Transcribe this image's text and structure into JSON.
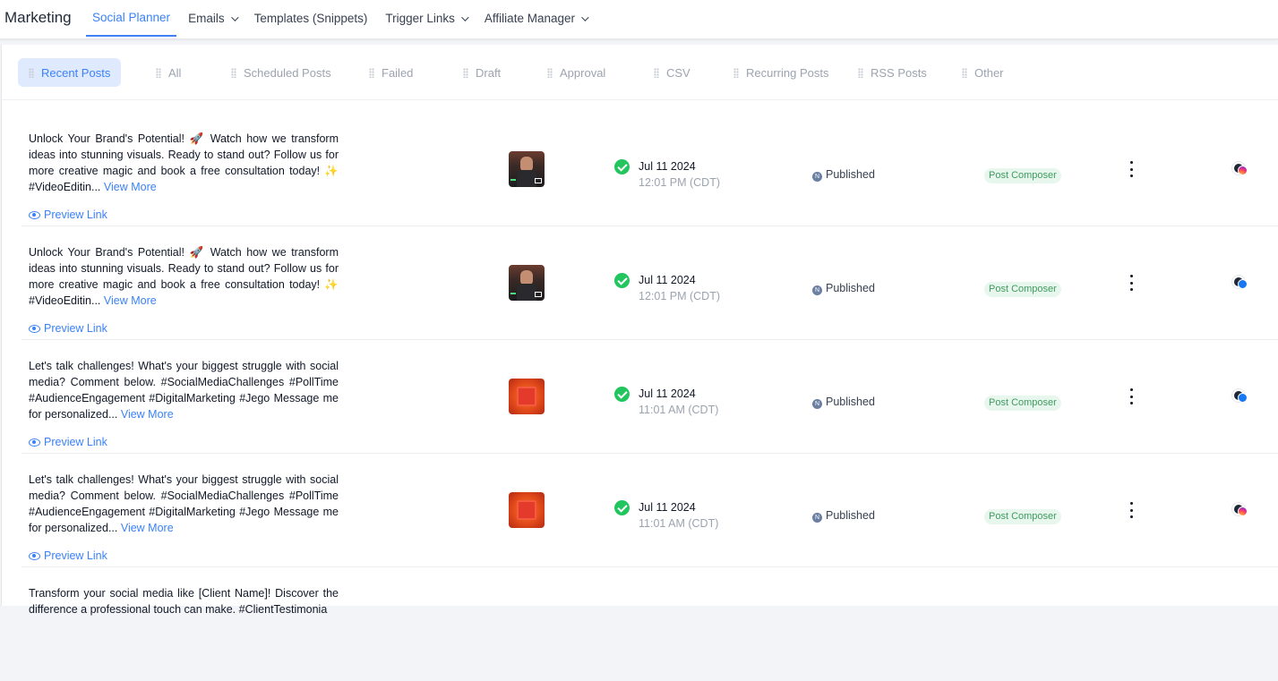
{
  "header": {
    "brand": "Marketing",
    "nav": [
      {
        "label": "Social Planner",
        "active": true,
        "dropdown": false
      },
      {
        "label": "Emails",
        "active": false,
        "dropdown": true
      },
      {
        "label": "Templates (Snippets)",
        "active": false,
        "dropdown": false
      },
      {
        "label": "Trigger Links",
        "active": false,
        "dropdown": true
      },
      {
        "label": "Affiliate Manager",
        "active": false,
        "dropdown": true
      }
    ]
  },
  "tabs": [
    {
      "label": "Recent Posts",
      "active": true
    },
    {
      "label": "All"
    },
    {
      "label": "Scheduled Posts"
    },
    {
      "label": "Failed"
    },
    {
      "label": "Draft"
    },
    {
      "label": "Approval"
    },
    {
      "label": "CSV"
    },
    {
      "label": "Recurring Posts"
    },
    {
      "label": "RSS Posts"
    },
    {
      "label": "Other"
    }
  ],
  "posts": [
    {
      "caption": "Unlock Your Brand's Potential! 🚀 Watch how we transform ideas into stunning visuals. Ready to stand out? Follow us for more creative magic and book a free consultation today! ✨ #VideoEditin...",
      "view_more": "View More",
      "preview_link": "Preview Link",
      "thumbnail": "video-thumbnail",
      "date": "Jul 11 2024",
      "time": "12:01 PM (CDT)",
      "status": "Published",
      "source": "Post Composer",
      "social": "instagram-icon"
    },
    {
      "caption": "Unlock Your Brand's Potential! 🚀 Watch how we transform ideas into stunning visuals. Ready to stand out? Follow us for more creative magic and book a free consultation today! ✨ #VideoEditin...",
      "view_more": "View More",
      "preview_link": "Preview Link",
      "thumbnail": "video-thumbnail",
      "date": "Jul 11 2024",
      "time": "12:01 PM (CDT)",
      "status": "Published",
      "source": "Post Composer",
      "social": "facebook-icon"
    },
    {
      "caption": "Let's talk challenges! What's your biggest struggle with social media? Comment below. #SocialMediaChallenges #PollTime #AudienceEngagement #DigitalMarketing #Jego Message me for personalized...",
      "view_more": "View More",
      "preview_link": "Preview Link",
      "thumbnail": "poll-thumbnail",
      "date": "Jul 11 2024",
      "time": "11:01 AM (CDT)",
      "status": "Published",
      "source": "Post Composer",
      "social": "facebook-icon"
    },
    {
      "caption": "Let's talk challenges! What's your biggest struggle with social media? Comment below. #SocialMediaChallenges #PollTime #AudienceEngagement #DigitalMarketing #Jego Message me for personalized...",
      "view_more": "View More",
      "preview_link": "Preview Link",
      "thumbnail": "poll-thumbnail",
      "date": "Jul 11 2024",
      "time": "11:01 AM (CDT)",
      "status": "Published",
      "source": "Post Composer",
      "social": "instagram-icon"
    },
    {
      "caption": "Transform your social media like [Client Name]! Discover the difference a professional touch can make. #ClientTestimonia"
    }
  ],
  "colors": {
    "accent": "#3b82f6",
    "success": "#22c55e",
    "badge_bg": "#e8f7ee",
    "badge_text": "#3f9a5f"
  }
}
